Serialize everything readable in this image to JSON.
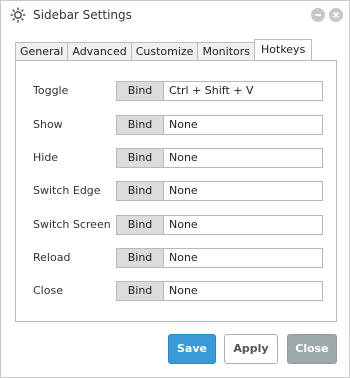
{
  "window": {
    "title": "Sidebar Settings",
    "icon": "gear-icon"
  },
  "tabs": [
    {
      "label": "General",
      "active": false
    },
    {
      "label": "Advanced",
      "active": false
    },
    {
      "label": "Customize",
      "active": false
    },
    {
      "label": "Monitors",
      "active": false
    },
    {
      "label": "Hotkeys",
      "active": true
    }
  ],
  "hotkeys": [
    {
      "label": "Toggle",
      "button": "Bind",
      "value": "Ctrl + Shift + V"
    },
    {
      "label": "Show",
      "button": "Bind",
      "value": "None"
    },
    {
      "label": "Hide",
      "button": "Bind",
      "value": "None"
    },
    {
      "label": "Switch Edge",
      "button": "Bind",
      "value": "None"
    },
    {
      "label": "Switch Screen",
      "button": "Bind",
      "value": "None"
    },
    {
      "label": "Reload",
      "button": "Bind",
      "value": "None"
    },
    {
      "label": "Close",
      "button": "Bind",
      "value": "None"
    }
  ],
  "footer": {
    "save_label": "Save",
    "apply_label": "Apply",
    "close_label": "Close"
  },
  "colors": {
    "accent": "#3a99d8",
    "close_button": "#9ea9ab",
    "window_controls": "#c7c7c7"
  }
}
